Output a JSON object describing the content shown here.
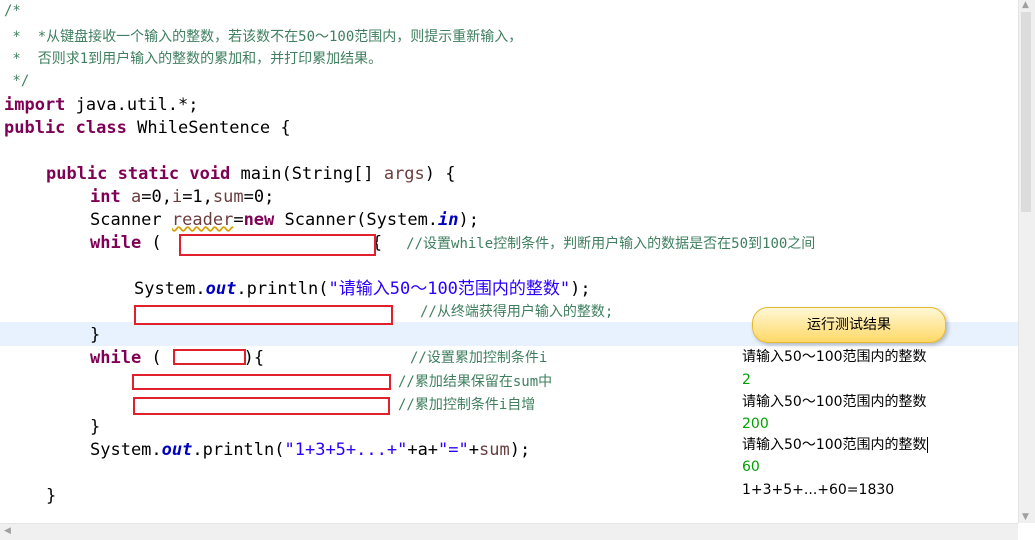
{
  "code": {
    "l1": "/*",
    "l2": " *  *从键盘接收一个输入的整数，若该数不在50～100范围内，则提示重新输入，",
    "l3": " *  否则求1到用户输入的整数的累加和，并打印累加结果。",
    "l4": " */",
    "import_kw": "import",
    "import_rest": " java.util.*;",
    "public_kw": "public",
    "class_kw": "class",
    "class_name": " WhileSentence {",
    "public2": "public",
    "static_kw": "static",
    "void_kw": "void",
    "main_sig": " main(String[] ",
    "args": "args",
    "main_end": ") {",
    "int_kw": "int",
    "decl_a": "a",
    "decl_eq0": "=0,",
    "decl_i": "i",
    "decl_eq1": "=1,",
    "decl_sum": "sum",
    "decl_end": "=0;",
    "scanner_type": "Scanner ",
    "reader": "reader",
    "eq": "=",
    "new_kw": "new",
    "scanner_ctor": " Scanner(System.",
    "in_field": "in",
    "scanner_end": ");",
    "while_kw": "while",
    "while1_open": " (",
    "while1_close": "){",
    "while1_comment": "//设置while控制条件，判断用户输入的数据是否在50到100之间",
    "println1_pre": "System.",
    "out_field": "out",
    "println1_mid": ".println(",
    "println1_str": "\"请输入50～100范围内的整数\"",
    "println1_end": ");",
    "read_comment": "//从终端获得用户输入的整数;",
    "close_brace": "}",
    "while2_open": " (",
    "while2_close": "){",
    "while2_comment": "//设置累加控制条件i",
    "sum_comment": "//累加结果保留在sum中",
    "inc_comment": "//累加控制条件i自增",
    "println2_pre": "System.",
    "println2_mid": ".println(",
    "println2_str": "\"1+3+5+...+\"",
    "println2_plus_a": "+a+",
    "println2_str2": "\"=\"",
    "println2_plus": "+",
    "println2_sum": "sum",
    "println2_end": ");"
  },
  "console": {
    "title": "运行测试结果",
    "lines": [
      "请输入50～100范围内的整数",
      "2",
      "请输入50～100范围内的整数",
      "200",
      "请输入50～100范围内的整数",
      "60",
      "1+3+5+...+60=1830"
    ]
  }
}
